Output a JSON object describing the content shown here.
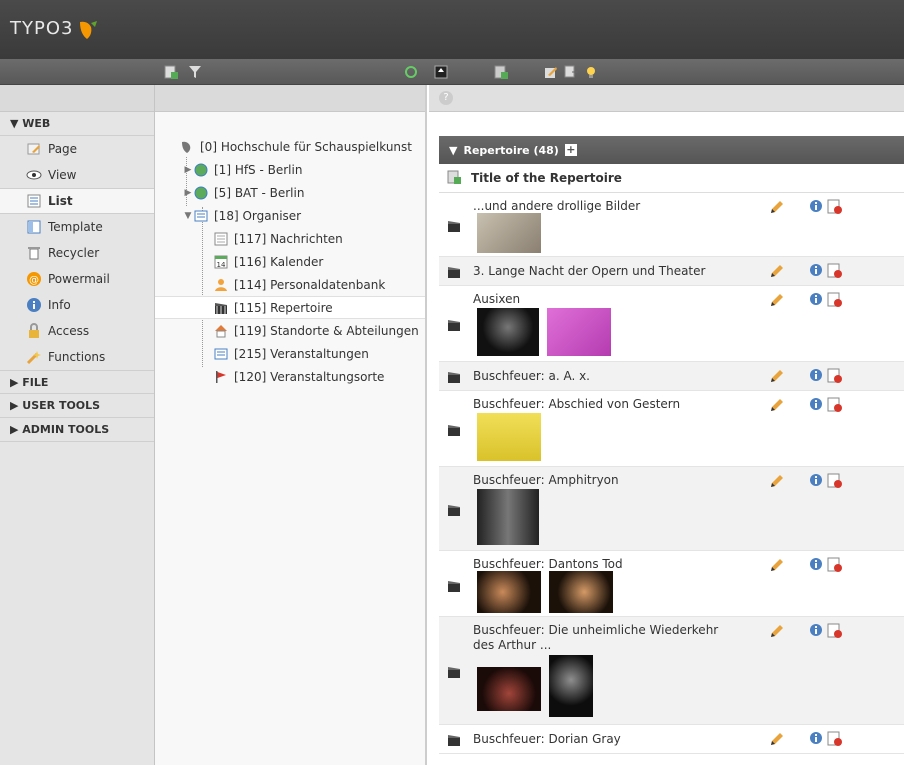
{
  "app": {
    "logo_text": "TYPO3"
  },
  "modules": {
    "groups": [
      {
        "label": "▼ WEB"
      },
      {
        "label": "▶ FILE"
      },
      {
        "label": "▶ USER TOOLS"
      },
      {
        "label": "▶ ADMIN TOOLS"
      }
    ],
    "web_items": [
      {
        "label": "Page",
        "icon": "page-edit-icon"
      },
      {
        "label": "View",
        "icon": "eye-icon"
      },
      {
        "label": "List",
        "icon": "list-icon"
      },
      {
        "label": "Template",
        "icon": "template-icon"
      },
      {
        "label": "Recycler",
        "icon": "recycler-icon"
      },
      {
        "label": "Powermail",
        "icon": "powermail-icon"
      },
      {
        "label": "Info",
        "icon": "info-icon"
      },
      {
        "label": "Access",
        "icon": "lock-icon"
      },
      {
        "label": "Functions",
        "icon": "functions-wand-icon"
      }
    ],
    "active": "List"
  },
  "tree": {
    "nodes": [
      {
        "label": "[0] Hochschule für Schauspielkunst"
      },
      {
        "label": "[1] HfS - Berlin"
      },
      {
        "label": "[5] BAT - Berlin"
      },
      {
        "label": "[18] Organiser"
      },
      {
        "label": "[117] Nachrichten"
      },
      {
        "label": "[116] Kalender"
      },
      {
        "label": "[114] Personaldatenbank"
      },
      {
        "label": "[115] Repertoire"
      },
      {
        "label": "[119] Standorte & Abteilungen"
      },
      {
        "label": "[215] Veranstaltungen"
      },
      {
        "label": "[120] Veranstaltungsorte"
      }
    ],
    "selected": "[115] Repertoire",
    "calendar_day": "14"
  },
  "list": {
    "table_title": "Repertoire (48)",
    "add_label": "+",
    "column_title": "Title of the Repertoire",
    "help_label": "?",
    "rows": [
      {
        "title": "...und andere drollige Bilder"
      },
      {
        "title": "3. Lange Nacht der Opern und Theater"
      },
      {
        "title": "Ausixen"
      },
      {
        "title": "Buschfeuer: a. A. x."
      },
      {
        "title": "Buschfeuer: Abschied von Gestern"
      },
      {
        "title": "Buschfeuer: Amphitryon"
      },
      {
        "title": "Buschfeuer: Dantons Tod"
      },
      {
        "title": "Buschfeuer: Die unheimliche Wiederkehr des Arthur ..."
      },
      {
        "title": "Buschfeuer: Dorian Gray"
      }
    ]
  },
  "colors": {
    "header_bg": "#3f3f3f",
    "toolbar_bg": "#5f5f5f",
    "menu_bg": "#e5e5e5",
    "table_head_bg": "#5e5e5e",
    "typo3_orange": "#f49700"
  }
}
